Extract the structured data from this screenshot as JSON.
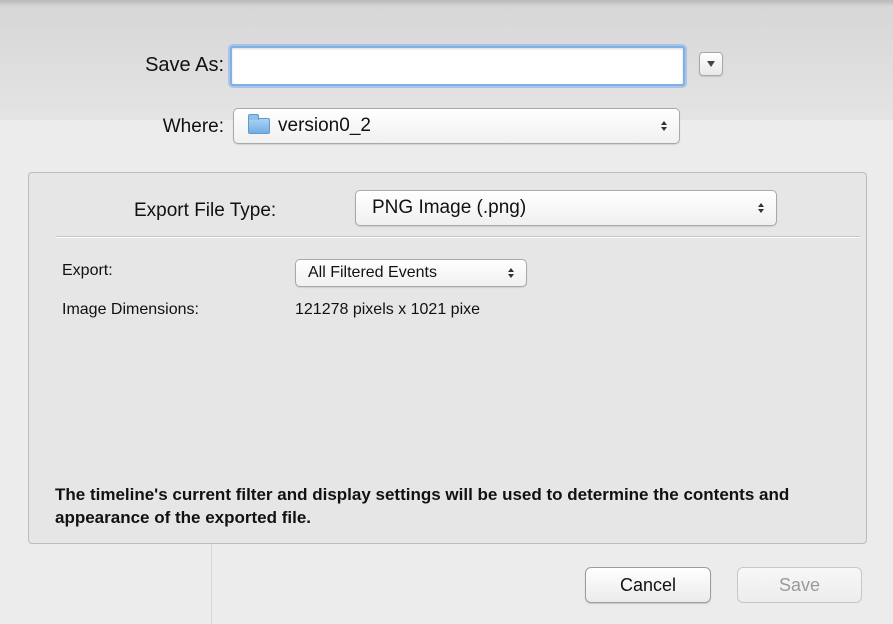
{
  "form": {
    "save_as_label": "Save As:",
    "save_as_value": "",
    "where_label": "Where:",
    "where_value": "version0_2"
  },
  "options": {
    "export_file_type_label": "Export File Type:",
    "export_file_type_value": "PNG Image (.png)",
    "export_label": "Export:",
    "export_value": "All Filtered Events",
    "image_dimensions_label": "Image Dimensions:",
    "image_dimensions_value": "121278 pixels x 1021 pixe",
    "info_text": "The timeline's current filter and display settings will be used to determine the contents and appearance of the exported file."
  },
  "buttons": {
    "cancel_label": "Cancel",
    "save_label": "Save"
  },
  "icons": {
    "expand": "chevron-down-icon",
    "folder": "folder-icon",
    "popup_arrows": "up-down-arrows-icon"
  },
  "colors": {
    "focus_ring": "#7fb0e6",
    "folder": "#72aee3",
    "disabled_text": "#9a9a9a"
  }
}
